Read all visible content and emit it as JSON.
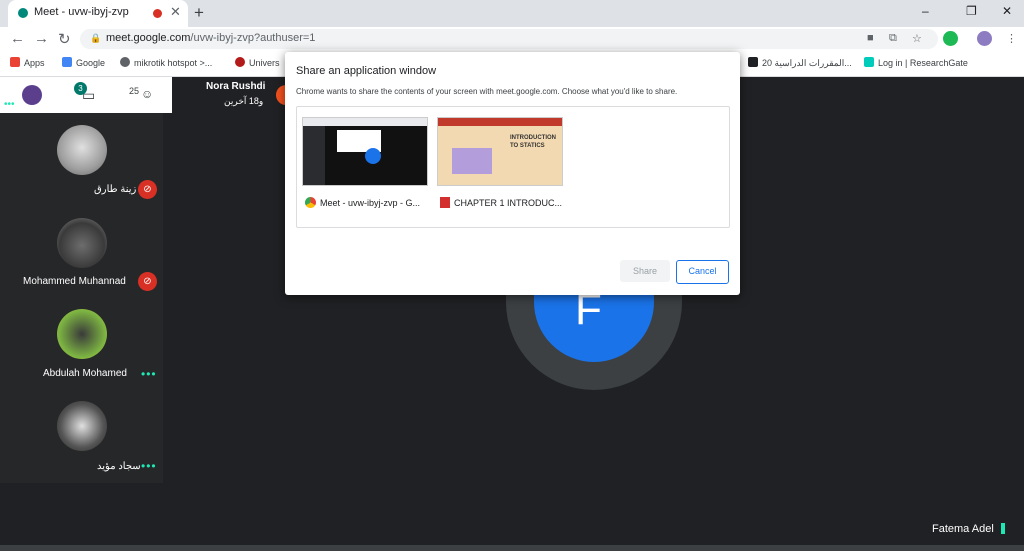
{
  "browser": {
    "tab_title": "Meet - uvw-ibyj-zvp",
    "new_tab": "+",
    "url_host": "meet.google.com",
    "url_path": "/uvw-ibyj-zvp?authuser=1",
    "window_controls": [
      "–",
      "❐",
      "✕"
    ]
  },
  "bookmarks": [
    {
      "label": "Apps",
      "icon": "apps-grid-icon",
      "color": "#ea4335"
    },
    {
      "label": "Google",
      "icon": "google-icon",
      "color": "#4285f4"
    },
    {
      "label": "mikrotik hotspot >...",
      "icon": "globe-icon",
      "color": "#5f6368"
    },
    {
      "label": "Univers",
      "icon": "university-icon",
      "color": "#b31b1b"
    },
    {
      "label": "المقررات الدراسية 20...",
      "icon": "book-icon",
      "color": "#202124"
    },
    {
      "label": "Log in | ResearchGate",
      "icon": "researchgate-icon",
      "color": "#00ccbb"
    }
  ],
  "meet": {
    "presenter_name": "Nora Rushdi",
    "presenter_sub": "و18 آخرين",
    "chat_badge": "3",
    "people_count": "25",
    "participants": [
      {
        "name": "زينة طارق",
        "status": "muted"
      },
      {
        "name": "Mohammed Muhannad",
        "status": "muted"
      },
      {
        "name": "Abdulah Mohamed",
        "status": "speaking"
      },
      {
        "name": "سجاد مؤيد",
        "status": "speaking"
      }
    ],
    "self_letter": "F",
    "self_name": "Fatema Adel",
    "dots": "•••"
  },
  "dialog": {
    "title": "Share an application window",
    "subtitle": "Chrome wants to share the contents of your screen with meet.google.com. Choose what you'd like to share.",
    "windows": [
      {
        "label": "Meet - uvw-ibyj-zvp - G...",
        "icon": "chrome-icon"
      },
      {
        "label": "CHAPTER 1  INTRODUC...",
        "icon": "pdf-icon",
        "preview_title": "Introduction to Statics"
      }
    ],
    "share_label": "Share",
    "cancel_label": "Cancel"
  },
  "colors": {
    "accent": "#1a73e8",
    "muted_red": "#d93025",
    "speaking_green": "#1de9b6",
    "meet_bg": "#202124"
  }
}
